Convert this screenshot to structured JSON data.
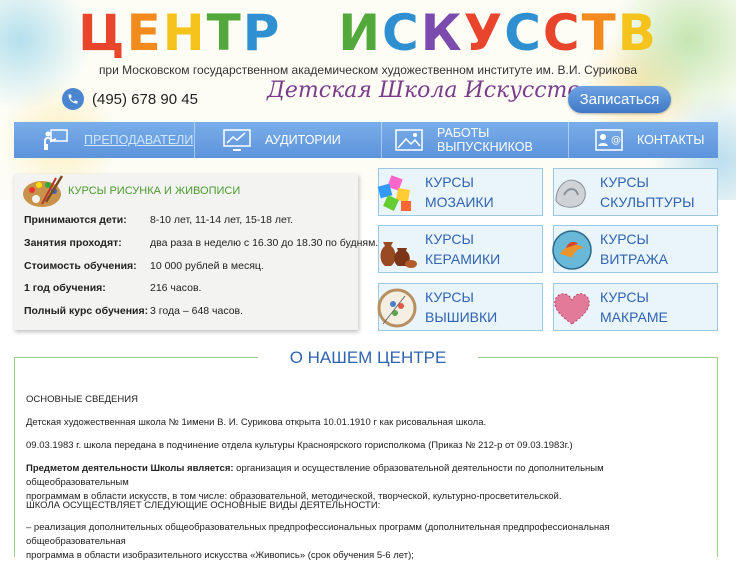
{
  "header": {
    "logo_word1": "ЦЕНТР",
    "logo_word2": "ИСКУССТВ",
    "subtitle": "при Московском государственном академическом художественном институте им. В.И. Сурикова",
    "phone": "(495) 678 90 45",
    "school_name": "Детская Школа Искусств",
    "signup_label": "Записаться",
    "colors": {
      "accent": "#4a86cf",
      "nav": "#6aa0e3",
      "green": "#4a9a2c"
    }
  },
  "nav": {
    "items": [
      {
        "label": "ПРЕПОДАВАТЕЛИ",
        "icon": "teacher-icon",
        "active": true
      },
      {
        "label": "АУДИТОРИИ",
        "icon": "monitor-chart-icon"
      },
      {
        "label": "РАБОТЫ ВЫПУСКНИКОВ",
        "icon": "picture-icon"
      },
      {
        "label": "КОНТАКТЫ",
        "icon": "contact-card-icon"
      }
    ]
  },
  "info": {
    "title": "КУРСЫ РИСУНКА И ЖИВОПИСИ",
    "rows": [
      {
        "k": "Принимаются дети:",
        "v": "8-10 лет, 11-14 лет, 15-18 лет."
      },
      {
        "k": "Занятия проходят:",
        "v": "два раза в неделю с 16.30 до 18.30 по будням."
      },
      {
        "k": "Стоимость обучения:",
        "v": "10 000 рублей в месяц."
      },
      {
        "k": "1 год обучения:",
        "v": "216 часов."
      },
      {
        "k": "Полный курс обучения:",
        "v": "3 года – 648 часов."
      }
    ]
  },
  "courses": [
    {
      "line1": "КУРСЫ МОЗАИКИ",
      "line2": "",
      "icon": "mosaic-cubes-icon"
    },
    {
      "line1": "КУРСЫ",
      "line2": "СКУЛЬПТУРЫ",
      "icon": "sculpture-icon"
    },
    {
      "line1": "КУРСЫ",
      "line2": "КЕРАМИКИ",
      "icon": "ceramics-vases-icon"
    },
    {
      "line1": "КУРСЫ ВИТРАЖА",
      "line2": "",
      "icon": "stained-glass-bird-icon"
    },
    {
      "line1": "КУРСЫ ВЫШИВКИ",
      "line2": "",
      "icon": "embroidery-hoop-icon"
    },
    {
      "line1": "КУРСЫ МАКРАМЕ",
      "line2": "",
      "icon": "macrame-heart-icon"
    }
  ],
  "about": {
    "title": "О НАШЕМ ЦЕНТРЕ",
    "heading": "ОСНОВНЫЕ СВЕДЕНИЯ",
    "p1": "Детская художественная школа № 1имени В. И. Сурикова открыта 10.01.1910 г как рисовальная школа.",
    "p2": "09.03.1983 г. школа передана в подчинение отдела культуры Красноярского горисполкома (Приказ № 212-р от 09.03.1983г.)",
    "p3_bold": "Предметом деятельности Школы является:",
    "p3_line1_rest": " организация и осуществление образовательной деятельности по дополнительным общеобразовательным",
    "p3_line2": "программам в области искусств, в том числе: образовательной, методической, творческой, культурно-просветительской.",
    "p4": "ШКОЛА ОСУЩЕСТВЛЯЕТ СЛЕДУЮЩИЕ ОСНОВНЫЕ ВИДЫ ДЕЯТЕЛЬНОСТИ:",
    "p5_line1": "– реализация дополнительных общеобразовательных предпрофессиональных программ (дополнительная предпрофессиональная общеобразовательная",
    "p5_line2": "программа в области изобразительного искусства «Живопись» (срок обучения 5-6 лет);"
  }
}
